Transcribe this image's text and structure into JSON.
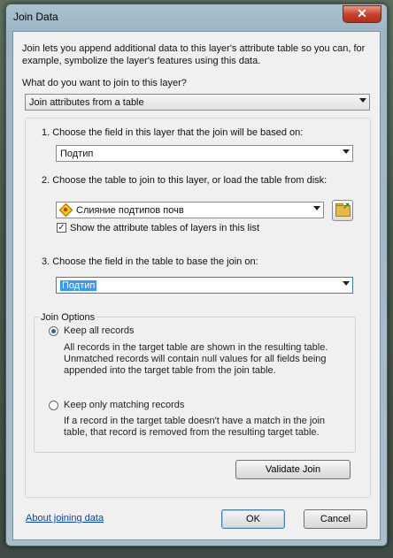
{
  "window": {
    "title": "Join Data",
    "close_glyph": "✕"
  },
  "intro": "Join lets you append additional data to this layer's attribute table so you can, for example, symbolize the layer's features using this data.",
  "question": "What do you want to join to this layer?",
  "join_type": {
    "value": "Join attributes from a table"
  },
  "step1": {
    "label": "1.  Choose the field in this layer that the join will be based on:",
    "value": "Подтип"
  },
  "step2": {
    "label": "2.  Choose the table to join to this layer, or load the table from disk:",
    "value": "Слияние подтипов почв",
    "checkbox_label": "Show the attribute tables of layers in this list",
    "checkbox_checked": "✓"
  },
  "step3": {
    "label": "3.  Choose the field in the table to base the join on:",
    "value": "Подтип"
  },
  "join_options": {
    "legend": "Join Options",
    "keep_all": {
      "label": "Keep all records",
      "desc1": "All records in the target table are shown in the resulting table.",
      "desc2": "Unmatched records will contain null values for all fields being",
      "desc3": "appended into the target table from the join table."
    },
    "keep_matching": {
      "label": "Keep only matching records",
      "desc1": "If a record in the target table doesn't have a match in the join",
      "desc2": "table, that record is removed from the resulting target table."
    }
  },
  "buttons": {
    "validate": "Validate Join",
    "ok": "OK",
    "cancel": "Cancel",
    "about_link": "About joining data"
  }
}
